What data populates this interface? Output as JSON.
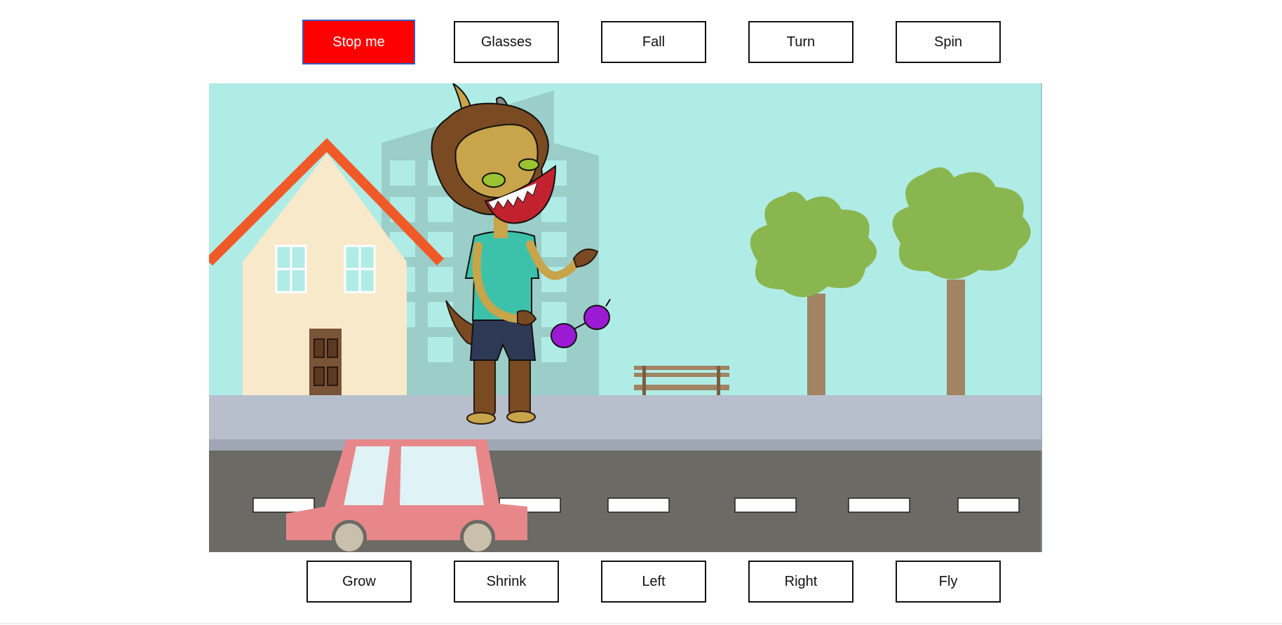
{
  "top_buttons": [
    {
      "label": "Stop me"
    },
    {
      "label": "Glasses"
    },
    {
      "label": "Fall"
    },
    {
      "label": "Turn"
    },
    {
      "label": "Spin"
    }
  ],
  "bottom_buttons": [
    {
      "label": "Grow"
    },
    {
      "label": "Shrink"
    },
    {
      "label": "Left"
    },
    {
      "label": "Right"
    },
    {
      "label": "Fly"
    }
  ],
  "colors": {
    "stop_button_bg": "#ff0000",
    "sky": "#b0ece6",
    "road": "#6b6a64",
    "sidewalk": "#b7bfcc",
    "house_roof": "#f05a28",
    "house_wall": "#f8e9cb",
    "car": "#e8878a",
    "tree_leaves": "#8ab650",
    "glasses": "#9b1bd4"
  },
  "scene": {
    "character": "horned-monster",
    "objects": [
      "house",
      "building",
      "bench",
      "trees",
      "car",
      "glasses"
    ]
  }
}
